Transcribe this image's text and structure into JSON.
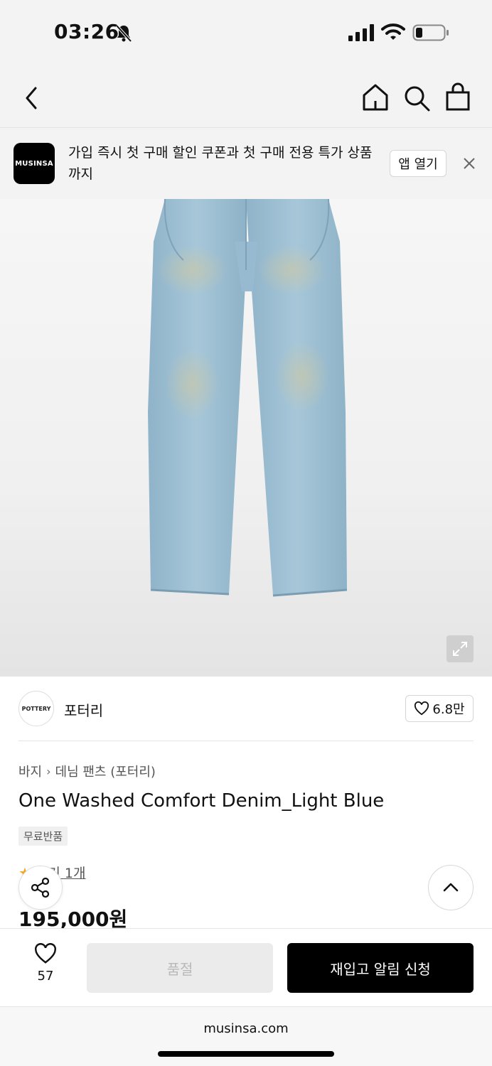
{
  "status_bar": {
    "time": "03:26"
  },
  "promo": {
    "logo_text": "MUSINSA",
    "message": "가입 즉시 첫 구매 할인 쿠폰과 첫 구매 전용 특가 상품까지",
    "open_app_label": "앱 열기"
  },
  "brand": {
    "logo_text": "POTTERY",
    "name": "포터리",
    "likes": "6.8만"
  },
  "breadcrumb": [
    "바지",
    "데님 팬츠 (포터리)"
  ],
  "product": {
    "title": "One Washed Comfort Denim_Light Blue",
    "badge": "무료반품",
    "review_label": "후기 1개",
    "price": "195,000원"
  },
  "bottom_bar": {
    "wishlist_count": "57",
    "soldout_label": "품절",
    "restock_label": "재입고 알림 신청"
  },
  "browser": {
    "url": "musinsa.com"
  },
  "colors": {
    "accent": "#000000",
    "denim": "#9bbfd4",
    "star": "#f5a623"
  },
  "icons": [
    "bell-off-icon",
    "signal-icon",
    "wifi-icon",
    "battery-icon",
    "back-icon",
    "home-icon",
    "search-icon",
    "bag-icon",
    "close-icon",
    "expand-icon",
    "heart-icon",
    "share-icon",
    "chevron-up-icon",
    "star-icon"
  ]
}
